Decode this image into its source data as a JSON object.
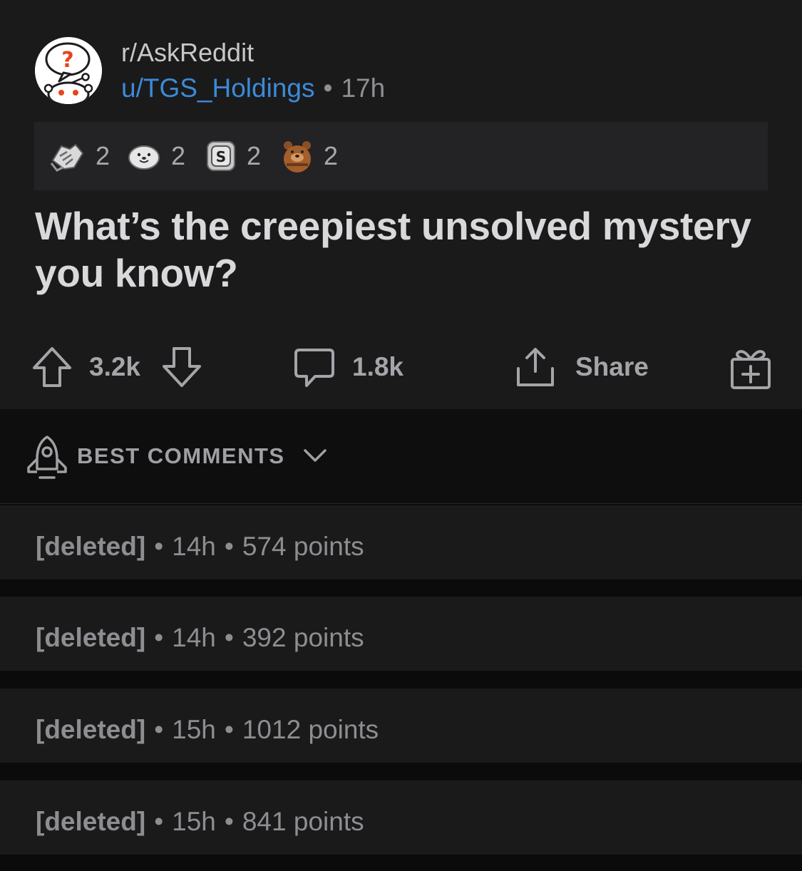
{
  "post": {
    "subreddit": "r/AskReddit",
    "username": "u/TGS_Holdings",
    "separator": "•",
    "time": "17h",
    "title": "What’s the creepiest unsolved mystery you know?"
  },
  "awards": [
    {
      "icon": "handshake-award-icon",
      "count": "2"
    },
    {
      "icon": "wholesome-seal-award-icon",
      "count": "2"
    },
    {
      "icon": "silver-coin-award-icon",
      "count": "2"
    },
    {
      "icon": "bear-award-icon",
      "count": "2"
    }
  ],
  "actions": {
    "upvotes": "3.2k",
    "comments": "1.8k",
    "share_label": "Share"
  },
  "sort": {
    "label": "BEST COMMENTS"
  },
  "comments": [
    {
      "author": "[deleted]",
      "time": "14h",
      "points": "574 points"
    },
    {
      "author": "[deleted]",
      "time": "14h",
      "points": "392 points"
    },
    {
      "author": "[deleted]",
      "time": "15h",
      "points": "1012 points"
    },
    {
      "author": "[deleted]",
      "time": "15h",
      "points": "841 points"
    }
  ],
  "colors": {
    "background": "#0b0b0c",
    "card": "#1a1a1b",
    "username_link": "#3c8ad8",
    "avatar_question_mark": "#e8431b"
  }
}
